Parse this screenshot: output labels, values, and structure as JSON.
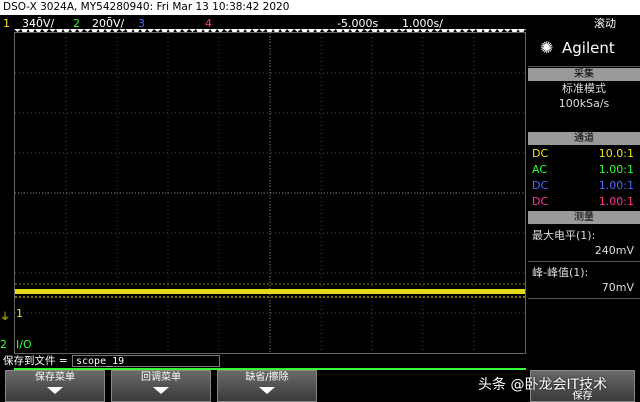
{
  "header": {
    "title": "DSO-X 3024A, MY54280940: Fri Mar 13 10:38:42 2020",
    "ch1_num": "1",
    "ch1_scale": "340̄V/",
    "ch2_num": "2",
    "ch2_scale": "200̄V/",
    "ch3_num": "3",
    "ch4_num": "4",
    "delay": "-5.000s",
    "timebase": "1.000s/",
    "mode": "滚动"
  },
  "brand": {
    "name": "Agilent"
  },
  "acquire": {
    "title": "采集",
    "mode": "标准模式",
    "rate": "100kSa/s"
  },
  "channels": {
    "title": "通道",
    "rows": [
      {
        "coupling": "DC",
        "probe": "10.0:1",
        "color": "#f2e51a"
      },
      {
        "coupling": "AC",
        "probe": "1.00:1",
        "color": "#33ff33"
      },
      {
        "coupling": "DC",
        "probe": "1.00:1",
        "color": "#4a6bff"
      },
      {
        "coupling": "DC",
        "probe": "1.00:1",
        "color": "#ff3399"
      }
    ]
  },
  "measure": {
    "title": "测量",
    "m1_label": "最大电平(1):",
    "m1_value": "240mV",
    "m2_label": "峰-峰值(1):",
    "m2_value": "70mV"
  },
  "markers": {
    "ch1": "1",
    "ch2": "2",
    "io": "I/O"
  },
  "filebar": {
    "label": "保存到文件 =",
    "filename": "scope_19"
  },
  "softkeys": {
    "k1": "保存菜单",
    "k2": "回调菜单",
    "k3": "缺省/擦除",
    "k6": "保存"
  },
  "watermark": "头条 @卧龙会IT技术",
  "colors": {
    "ch1": "#f2e51a",
    "ch2": "#33ff33",
    "ch3": "#4a6bff",
    "ch4": "#ff3399",
    "panel_head": "#9a9a9a"
  }
}
